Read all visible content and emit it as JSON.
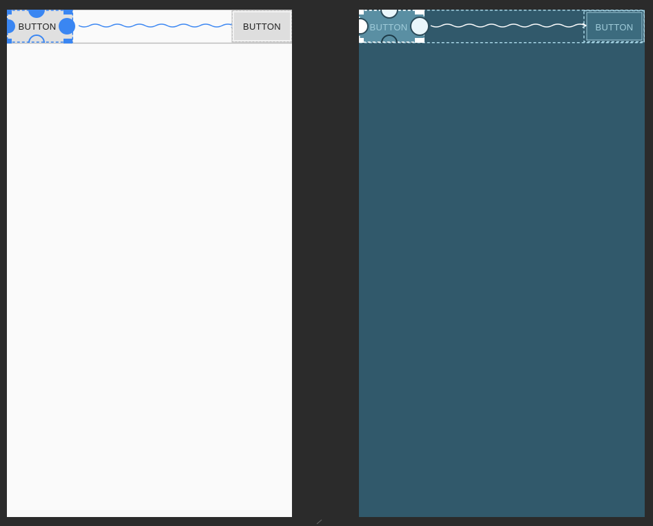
{
  "design_view": {
    "button_left": {
      "label": "BUTTON",
      "selected": true
    },
    "button_right": {
      "label": "BUTTON"
    },
    "constraint": "chain-link"
  },
  "blueprint_view": {
    "button_left": {
      "label": "BUTTON",
      "selected": true
    },
    "button_right": {
      "label": "BUTTON"
    },
    "constraint": "chain-link"
  },
  "colors": {
    "editor_background": "#2b2b2b",
    "design_surface": "#fafafa",
    "blueprint_surface": "#31596b",
    "selection_accent": "#3a86f2",
    "blueprint_outline": "#a9d8e8"
  }
}
